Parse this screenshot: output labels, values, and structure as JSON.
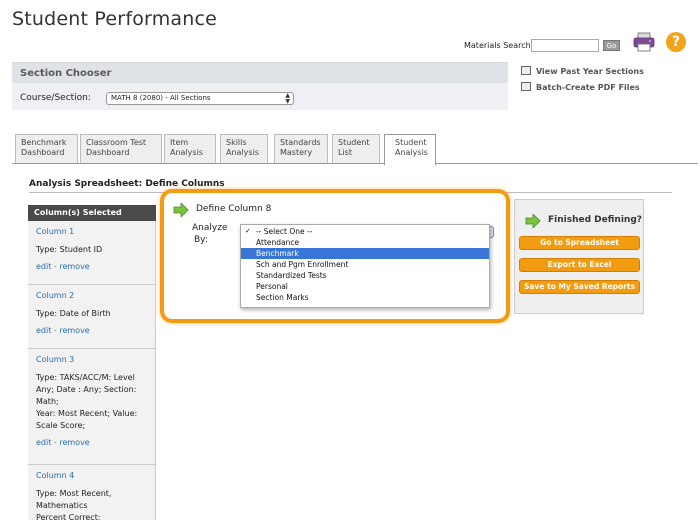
{
  "page": {
    "title": "Student Performance"
  },
  "header": {
    "materials_search_label": "Materials Search:",
    "materials_search_value": "",
    "go_label": "Go",
    "printer_icon": "printer-icon",
    "help_icon": "help-icon",
    "help_glyph": "?"
  },
  "section_chooser": {
    "title": "Section Chooser",
    "course_label": "Course/Section:",
    "course_value": "MATH 8 (2080) - All Sections"
  },
  "side_links": [
    {
      "label": "View Past Year Sections",
      "icon": "calendar-icon"
    },
    {
      "label": "Batch-Create PDF Files",
      "icon": "document-icon"
    }
  ],
  "tabs": [
    {
      "label_line1": "Benchmark",
      "label_line2": "Dashboard"
    },
    {
      "label_line1": "Classroom Test",
      "label_line2": "Dashboard"
    },
    {
      "label_line1": "Item",
      "label_line2": "Analysis"
    },
    {
      "label_line1": "Skills",
      "label_line2": "Analysis"
    },
    {
      "label_line1": "Standards",
      "label_line2": "Mastery"
    },
    {
      "label_line1": "Student",
      "label_line2": "List"
    },
    {
      "label_line1": "Student",
      "label_line2": "Analysis"
    }
  ],
  "active_tab": "Student Analysis",
  "spreadsheet": {
    "title": "Analysis Spreadsheet: Define Columns"
  },
  "columns_panel": {
    "header": "Column(s) Selected",
    "edit_label": "edit",
    "separator": "-",
    "remove_label": "remove",
    "items": [
      {
        "name": "Column 1",
        "type": "Type: Student ID"
      },
      {
        "name": "Column 2",
        "type": "Type: Date of Birth"
      },
      {
        "name": "Column 3",
        "type_lines": [
          "Type: TAKS/ACC/M: Level",
          "Any; Date : Any; Section:",
          "Math;",
          "Year: Most Recent; Value:",
          "Scale Score;"
        ]
      },
      {
        "name": "Column 4",
        "type_lines": [
          "Type: Most Recent,",
          "Mathematics",
          "Percent Correct;"
        ]
      }
    ]
  },
  "define": {
    "title": "Define Column 8",
    "analyze_label_line1": "Analyze",
    "analyze_label_line2": "By:",
    "options": [
      "-- Select One --",
      "Attendance",
      "Benchmark",
      "Sch and Pgm Enrollment",
      "Standardized Tests",
      "Personal",
      "Section Marks"
    ],
    "checked_option": "-- Select One --",
    "highlighted_option": "Benchmark",
    "check_glyph": "✓"
  },
  "finished": {
    "title": "Finished Defining?",
    "buttons": [
      "Go to Spreadsheet",
      "Export to Excel",
      "Save to My Saved Reports"
    ]
  },
  "colors": {
    "accent_orange": "#f39c12",
    "link_blue": "#2d6ca8",
    "highlight_blue": "#3875d7",
    "arrow_green": "#7cc142"
  }
}
